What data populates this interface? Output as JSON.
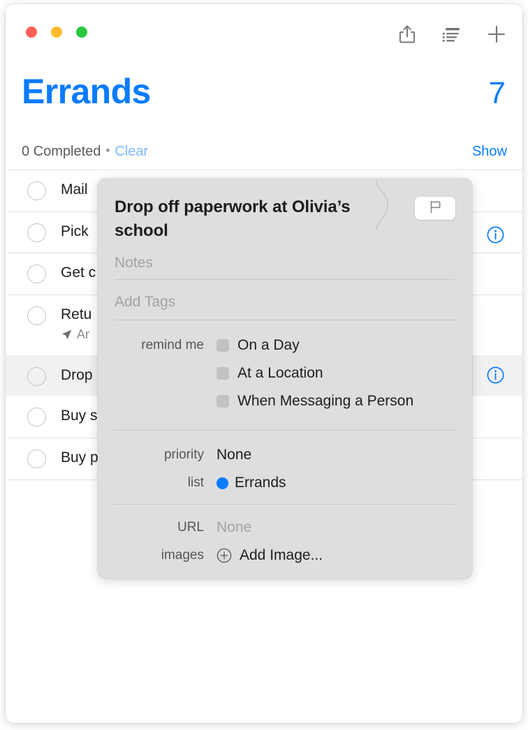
{
  "window": {
    "traffic_lights": [
      {
        "name": "close",
        "color": "#ff5f57"
      },
      {
        "name": "minimize",
        "color": "#febc2e"
      },
      {
        "name": "zoom",
        "color": "#28c840"
      }
    ],
    "toolbar_icons": [
      "share-icon",
      "sort-list-icon",
      "add-icon"
    ]
  },
  "header": {
    "title": "Errands",
    "count": "7",
    "completed_text": "0 Completed",
    "separator": "•",
    "clear_label": "Clear",
    "show_label": "Show",
    "accent_color": "#0a7cff",
    "clear_color": "#7cb8ff"
  },
  "reminders": [
    {
      "title": "Mail",
      "subtitle": "",
      "has_info": false,
      "selected": false
    },
    {
      "title": "Pick",
      "subtitle": "",
      "has_info": true,
      "selected": false
    },
    {
      "title": "Get c",
      "subtitle": "",
      "has_info": false,
      "selected": false
    },
    {
      "title": "Retu",
      "subtitle": "Ar",
      "has_info": false,
      "selected": false
    },
    {
      "title": "Drop",
      "subtitle": "",
      "has_info": true,
      "selected": true
    },
    {
      "title": "Buy s",
      "subtitle": "",
      "has_info": false,
      "selected": false
    },
    {
      "title": "Buy p",
      "subtitle": "",
      "has_info": false,
      "selected": false
    }
  ],
  "popover": {
    "title": "Drop off paperwork at Olivia’s school",
    "flag_icon": "flag-icon",
    "notes_placeholder": "Notes",
    "tags_placeholder": "Add Tags",
    "remind_me_label": "remind me",
    "remind_options": [
      {
        "label": "On a Day",
        "checked": false
      },
      {
        "label": "At a Location",
        "checked": false
      },
      {
        "label": "When Messaging a Person",
        "checked": false
      }
    ],
    "priority_label": "priority",
    "priority_value": "None",
    "list_label": "list",
    "list_value": "Errands",
    "list_color": "#0a7cff",
    "url_label": "URL",
    "url_value": "None",
    "images_label": "images",
    "images_action": "Add Image..."
  }
}
